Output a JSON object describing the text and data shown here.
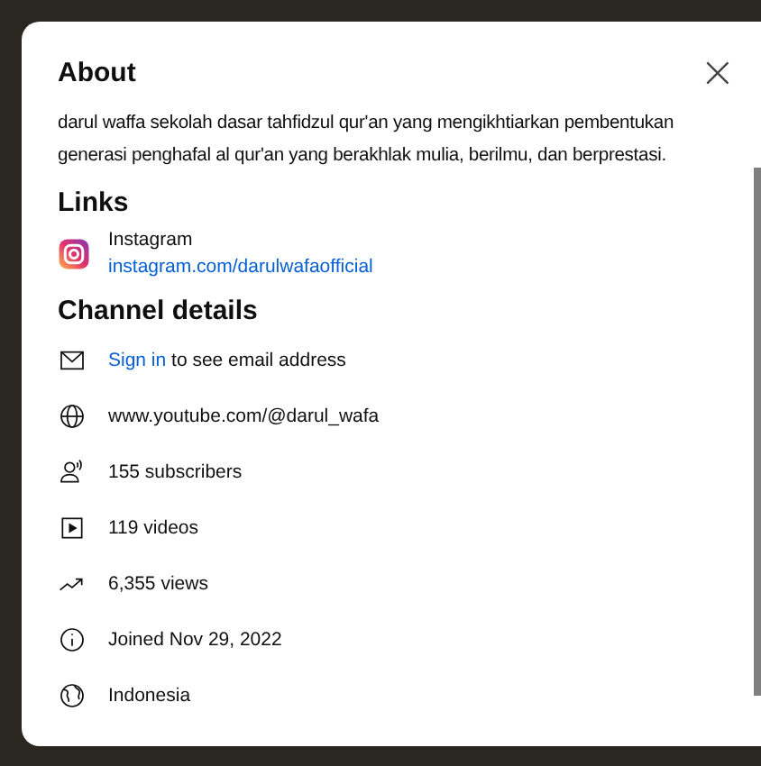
{
  "dialog": {
    "title": "About",
    "close_label": "×"
  },
  "description": "darul waffa sekolah dasar tahfidzul qur'an yang mengikhtiarkan pembentukan generasi penghafal al qur'an yang berakhlak mulia, berilmu, dan berprestasi.",
  "links": {
    "heading": "Links",
    "items": [
      {
        "name": "Instagram",
        "url": "instagram.com/darulwafaofficial"
      }
    ]
  },
  "channel_details": {
    "heading": "Channel details",
    "rows": [
      {
        "kind": "email",
        "link": "Sign in",
        "text": "to see email address"
      },
      {
        "kind": "website",
        "text": "www.youtube.com/@darul_wafa"
      },
      {
        "kind": "subscribers",
        "text": "155 subscribers"
      },
      {
        "kind": "videos",
        "text": "119 videos"
      },
      {
        "kind": "views",
        "text": "6,355 views"
      },
      {
        "kind": "joined",
        "text": "Joined Nov 29, 2022"
      },
      {
        "kind": "country",
        "text": "Indonesia"
      }
    ]
  }
}
